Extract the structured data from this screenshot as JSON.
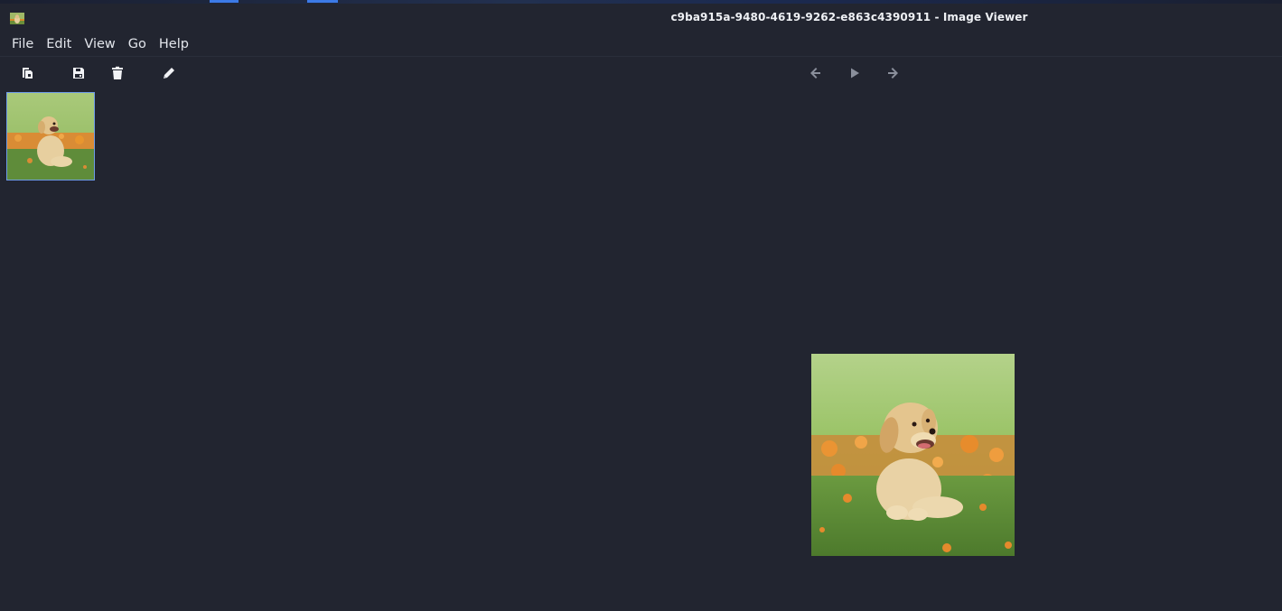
{
  "window": {
    "title": "c9ba915a-9480-4619-9262-e863c4390911 - Image Viewer"
  },
  "menu": {
    "items": [
      {
        "label": "File"
      },
      {
        "label": "Edit"
      },
      {
        "label": "View"
      },
      {
        "label": "Go"
      },
      {
        "label": "Help"
      }
    ]
  },
  "toolbar": {
    "left_icons": [
      "copy-icon",
      "save-icon",
      "trash-icon",
      "pencil-icon"
    ],
    "nav_icons": [
      "arrow-left-icon",
      "play-icon",
      "arrow-right-icon"
    ]
  },
  "thumbnails": [
    {
      "subject": "puppy-in-grass-icon",
      "selected": true
    }
  ],
  "viewer": {
    "image_subject": "golden-retriever-puppy-icon"
  },
  "colors": {
    "background": "#222530",
    "text": "#e3e6ec",
    "selection_border": "#6d9be8",
    "nav_icon": "#8a8f9b"
  }
}
